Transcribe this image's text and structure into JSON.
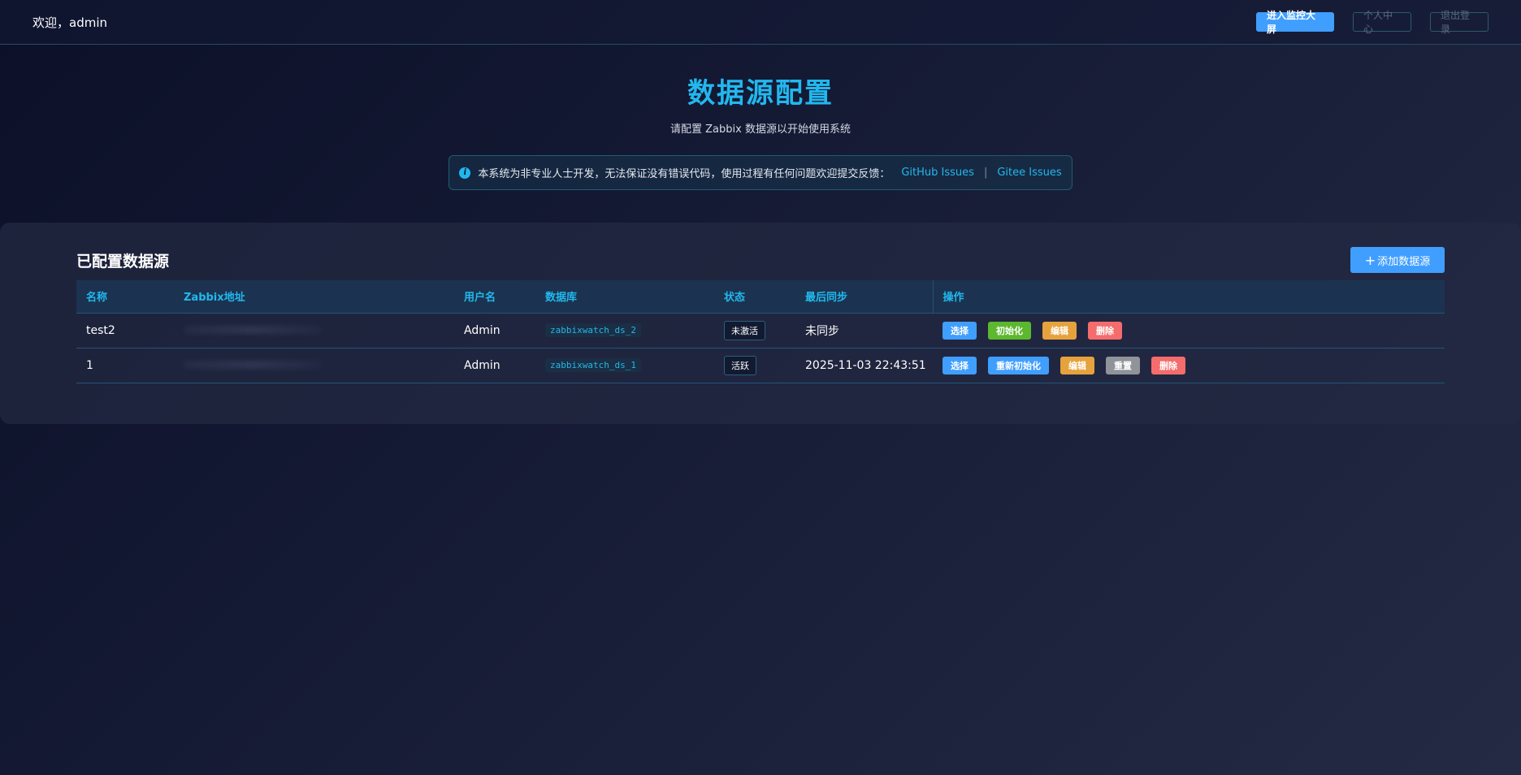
{
  "header": {
    "welcome": "欢迎，admin",
    "monitor_btn": "进入监控大屏",
    "profile_btn": "个人中心",
    "logout_btn": "退出登录"
  },
  "hero": {
    "title": "数据源配置",
    "subtitle": "请配置 Zabbix 数据源以开始使用系统"
  },
  "notice": {
    "text": "本系统为非专业人士开发，无法保证没有错误代码，使用过程有任何问题欢迎提交反馈：",
    "link_github": "GitHub Issues",
    "separator": "|",
    "link_gitee": "Gitee Issues"
  },
  "panel": {
    "title": "已配置数据源",
    "add_btn": "添加数据源",
    "columns": {
      "name": "名称",
      "url": "Zabbix地址",
      "user": "用户名",
      "db": "数据库",
      "status": "状态",
      "last_sync": "最后同步",
      "ops": "操作"
    },
    "rows": [
      {
        "name": "test2",
        "url": "",
        "user": "Admin",
        "db": "zabbixwatch_ds_2",
        "status": "未激活",
        "last_sync": "未同步",
        "actions": [
          "选择",
          "初始化",
          "编辑",
          "删除"
        ]
      },
      {
        "name": "1",
        "url": "",
        "user": "Admin",
        "db": "zabbixwatch_ds_1",
        "status": "活跃",
        "last_sync": "2025-11-03 22:43:51",
        "actions": [
          "选择",
          "重新初始化",
          "编辑",
          "重置",
          "删除"
        ]
      }
    ]
  },
  "colors": {
    "accent": "#22b8ee",
    "primary": "#409eff",
    "success": "#5cb82e",
    "warning": "#e6a23c",
    "danger": "#f56c6c",
    "info": "#909399"
  }
}
